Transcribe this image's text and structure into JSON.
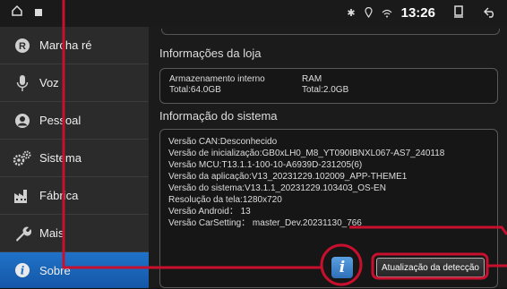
{
  "statusbar": {
    "clock": "13:26",
    "icons": [
      "home-icon",
      "app-icon",
      "bluetooth-icon",
      "location-icon",
      "wifi-icon",
      "recent-apps-icon",
      "back-icon"
    ]
  },
  "sidebar": {
    "items": [
      {
        "label": "Marcha ré",
        "icon": "reverse-gear-icon"
      },
      {
        "label": "Voz",
        "icon": "microphone-icon"
      },
      {
        "label": "Pessoal",
        "icon": "person-icon"
      },
      {
        "label": "Sistema",
        "icon": "gears-icon"
      },
      {
        "label": "Fábrica",
        "icon": "factory-icon"
      },
      {
        "label": "Mais",
        "icon": "wrench-icon"
      },
      {
        "label": "Sobre",
        "icon": "info-icon",
        "active": true
      }
    ]
  },
  "store": {
    "title": "Informações da loja",
    "internal_label": "Armazenamento interno",
    "internal_value": "Total:64.0GB",
    "ram_label": "RAM",
    "ram_value": "Total:2.0GB"
  },
  "system": {
    "title": "Informação do sistema",
    "lines": [
      "Versão CAN:Desconhecido",
      "Versão de inicialização:GB0xLH0_M8_YT090IBNXL067-AS7_240118",
      "Versão MCU:T13.1.1-100-10-A6939D-231205(6)",
      "Versão da aplicação:V13_20231229.102009_APP-THEME1",
      "Versão do sistema:V13.1.1_20231229.103403_OS-EN",
      "Resolução da tela:1280x720",
      "Versão Android： 13",
      "Versão CarSetting： master_Dev.20231130_766"
    ],
    "info_button_glyph": "i",
    "detect_button": "Atualização da detecção"
  },
  "colors": {
    "accent": "#1f72c8",
    "annotation": "#c8102e",
    "sidebar_bg": "#2b2b2b",
    "main_bg": "#1b1b1b"
  }
}
